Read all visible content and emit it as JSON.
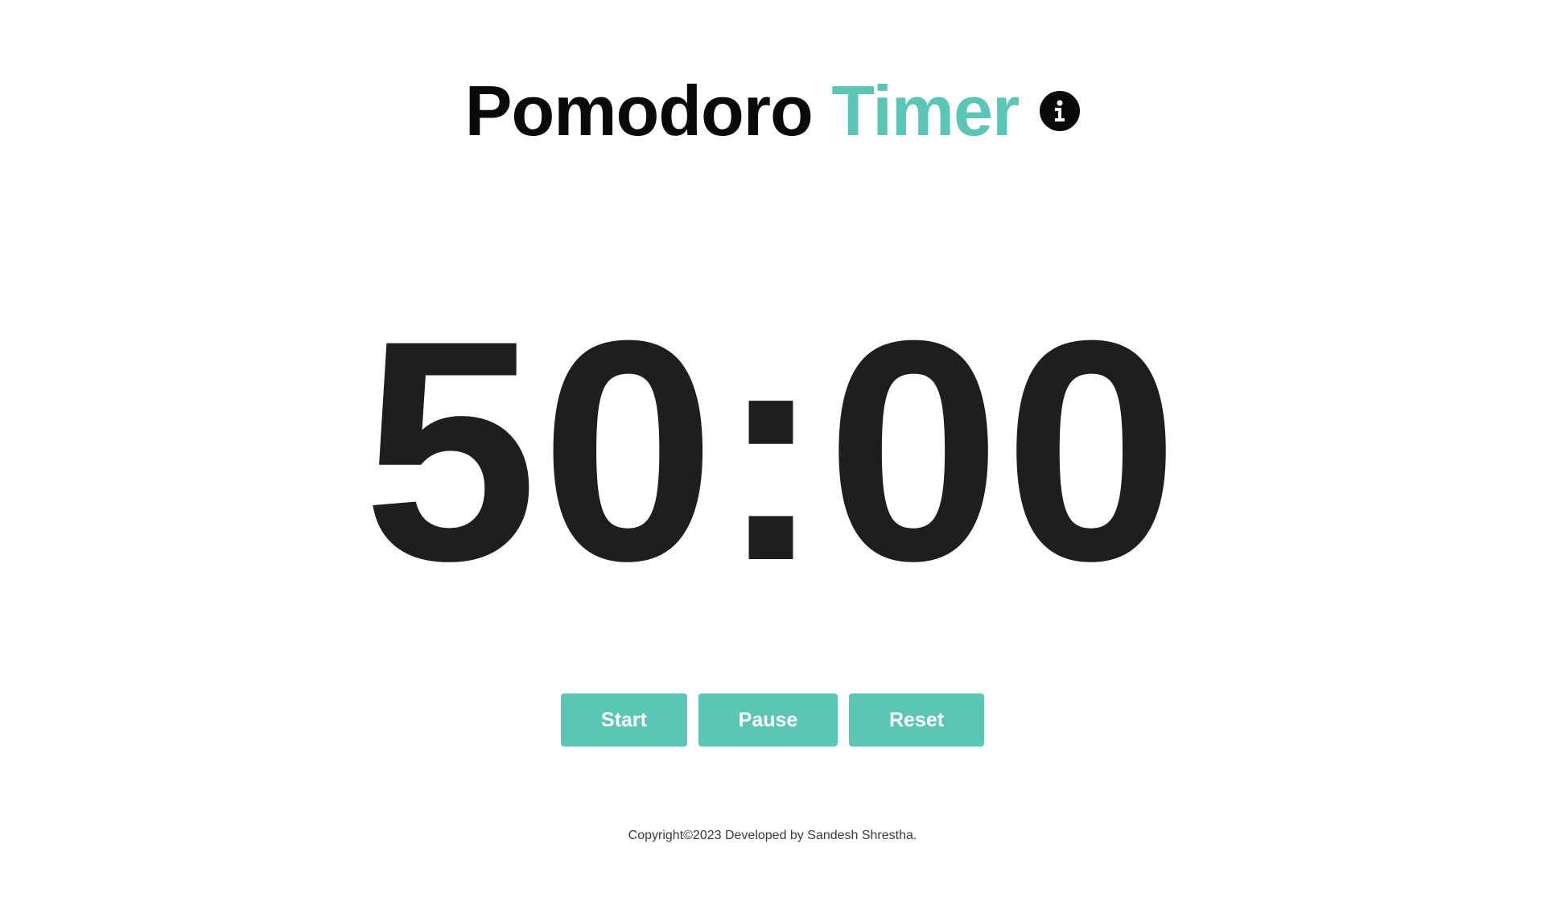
{
  "header": {
    "title_main": "Pomodoro",
    "title_accent": "Timer",
    "info_icon": "info-icon"
  },
  "timer": {
    "display": "50:00"
  },
  "controls": {
    "start_label": "Start",
    "pause_label": "Pause",
    "reset_label": "Reset"
  },
  "footer": {
    "text": "Copyright©2023 Developed by Sandesh Shrestha."
  },
  "colors": {
    "accent": "#5bc6b5",
    "text_dark": "#0a0a0a",
    "timer_text": "#1e1e1f",
    "background": "#ffffff"
  }
}
